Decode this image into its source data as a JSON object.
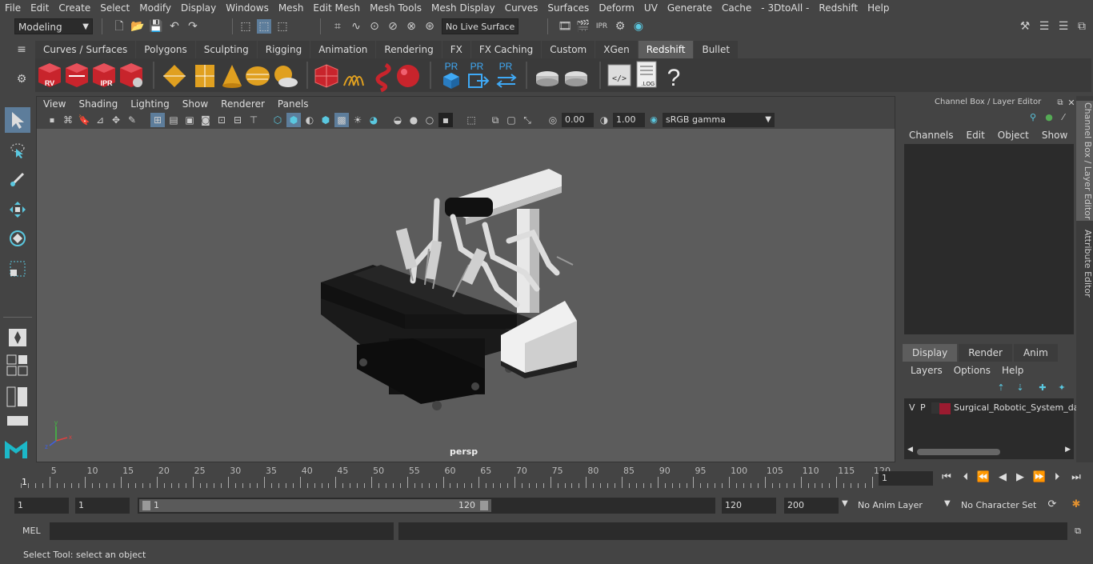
{
  "menubar": {
    "items": [
      "File",
      "Edit",
      "Create",
      "Select",
      "Modify",
      "Display",
      "Windows",
      "Mesh",
      "Edit Mesh",
      "Mesh Tools",
      "Mesh Display",
      "Curves",
      "Surfaces",
      "Deform",
      "UV",
      "Generate",
      "Cache",
      "- 3DtoAll -",
      "Redshift",
      "Help"
    ]
  },
  "statusline": {
    "mode": "Modeling",
    "live_surface": "No Live Surface"
  },
  "shelf": {
    "tabs": [
      "Curves / Surfaces",
      "Polygons",
      "Sculpting",
      "Rigging",
      "Animation",
      "Rendering",
      "FX",
      "FX Caching",
      "Custom",
      "XGen",
      "Redshift",
      "Bullet"
    ],
    "active_tab": "Redshift",
    "icons": [
      {
        "name": "redshift-rv-icon",
        "label": "RV"
      },
      {
        "name": "redshift-render-icon",
        "label": ""
      },
      {
        "name": "redshift-ipr-icon",
        "label": "IPR"
      },
      {
        "name": "redshift-settings-icon",
        "label": ""
      },
      {
        "name": "redshift-light-icon-1",
        "label": ""
      },
      {
        "name": "redshift-light-icon-2",
        "label": ""
      },
      {
        "name": "redshift-light-icon-3",
        "label": ""
      },
      {
        "name": "redshift-light-icon-4",
        "label": ""
      },
      {
        "name": "redshift-sun-icon",
        "label": ""
      },
      {
        "name": "redshift-proxy-icon",
        "label": ""
      },
      {
        "name": "redshift-hair-icon",
        "label": ""
      },
      {
        "name": "redshift-curve-icon",
        "label": ""
      },
      {
        "name": "redshift-sphere-icon",
        "label": ""
      },
      {
        "name": "pr-export-icon",
        "label": "PR"
      },
      {
        "name": "pr-import-icon",
        "label": "PR"
      },
      {
        "name": "pr-swap-icon",
        "label": "PR"
      },
      {
        "name": "pie-icon-1",
        "label": ""
      },
      {
        "name": "pie-icon-2",
        "label": ""
      },
      {
        "name": "code-icon",
        "label": ""
      },
      {
        "name": "log-icon",
        "label": ".LOG"
      },
      {
        "name": "help-icon",
        "label": "?"
      }
    ]
  },
  "viewport": {
    "menus": [
      "View",
      "Shading",
      "Lighting",
      "Show",
      "Renderer",
      "Panels"
    ],
    "exposure": "0.00",
    "gamma": "1.00",
    "color_space": "sRGB gamma",
    "camera_label": "persp"
  },
  "channel_box": {
    "title": "Channel Box / Layer Editor",
    "menus": [
      "Channels",
      "Edit",
      "Object",
      "Show"
    ]
  },
  "layer_editor": {
    "tabs": [
      "Display",
      "Render",
      "Anim"
    ],
    "active_tab": "Display",
    "menus": [
      "Layers",
      "Options",
      "Help"
    ],
    "layers": [
      {
        "v": "V",
        "p": "P",
        "color": "#9b1b30",
        "name": "Surgical_Robotic_System_da_"
      }
    ]
  },
  "side_tabs": [
    "Channel Box / Layer Editor",
    "Attribute Editor"
  ],
  "timeline": {
    "ticks": [
      5,
      10,
      15,
      20,
      25,
      30,
      35,
      40,
      45,
      50,
      55,
      60,
      65,
      70,
      75,
      80,
      85,
      90,
      95,
      100,
      105,
      110,
      115,
      120
    ],
    "current_marker": "1",
    "current_frame": "1"
  },
  "range": {
    "start": "1",
    "playback_start": "1",
    "slider_start": "1",
    "slider_end": "120",
    "playback_end": "120",
    "end": "200",
    "anim_layer": "No Anim Layer",
    "character_set": "No Character Set"
  },
  "mel": {
    "label": "MEL"
  },
  "help_line": "Select Tool: select an object"
}
